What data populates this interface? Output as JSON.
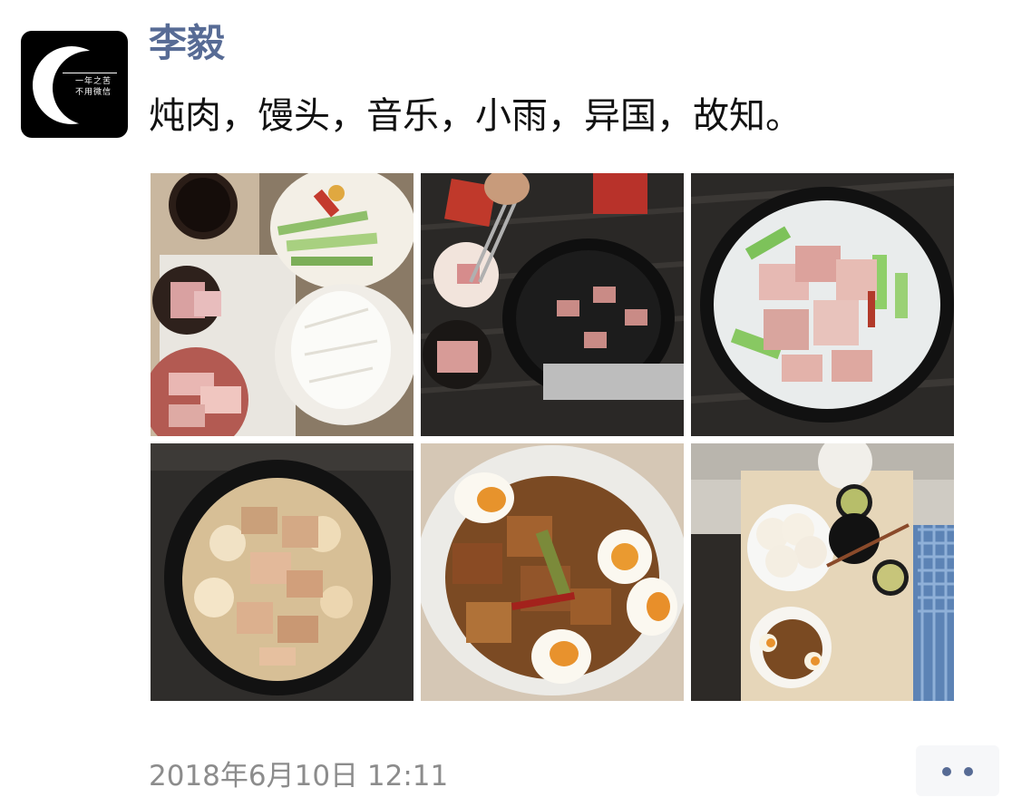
{
  "post": {
    "author": "李毅",
    "text": "炖肉，馒头，音乐，小雨，异国，故知。",
    "timestamp": "2018年6月10日 12:11"
  },
  "avatar": {
    "logo_line1": "一年之苦",
    "logo_line2": "不用微信"
  },
  "photos": [
    {
      "alt": "ingredients-raw-pork-leeks-radish"
    },
    {
      "alt": "searing-pork-in-pot"
    },
    {
      "alt": "pork-and-leeks-in-pot"
    },
    {
      "alt": "braised-pork-with-radish-in-pot"
    },
    {
      "alt": "braised-pork-with-eggs-bowl"
    },
    {
      "alt": "table-with-buns-and-braised-pork"
    }
  ],
  "actions": {
    "more_icon": "more-dots-icon"
  },
  "colors": {
    "name": "#576b95",
    "timestamp": "#8c8c8c",
    "text": "#111111"
  }
}
